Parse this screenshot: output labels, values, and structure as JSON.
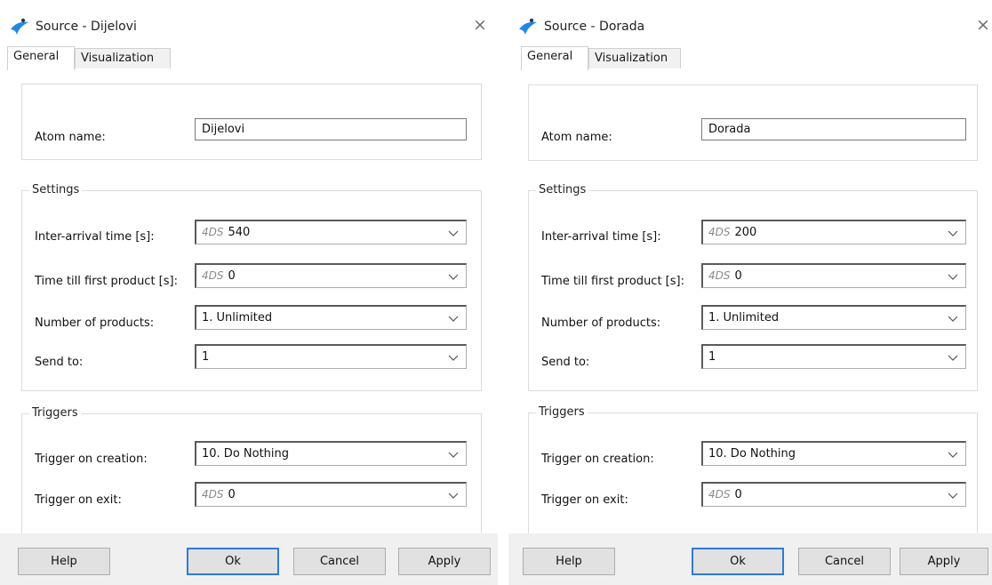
{
  "left": {
    "title": "Source - Dijelovi",
    "tabs": [
      "General",
      "Visualization"
    ],
    "atom_name_label": "Atom name:",
    "atom_name_value": "Dijelovi",
    "settings_legend": "Settings",
    "inter_arrival_label": "Inter-arrival time [s]:",
    "inter_arrival_prefix": "4DS",
    "inter_arrival_value": "540",
    "first_product_label": "Time till first product [s]:",
    "first_product_prefix": "4DS",
    "first_product_value": "0",
    "num_products_label": "Number of products:",
    "num_products_value": "1. Unlimited",
    "send_to_label": "Send to:",
    "send_to_value": "1",
    "triggers_legend": "Triggers",
    "trigger_creation_label": "Trigger on creation:",
    "trigger_creation_value": "10. Do Nothing",
    "trigger_exit_label": "Trigger on exit:",
    "trigger_exit_prefix": "4DS",
    "trigger_exit_value": "0",
    "buttons": {
      "help": "Help",
      "ok": "Ok",
      "cancel": "Cancel",
      "apply": "Apply"
    }
  },
  "right": {
    "title": "Source - Dorada",
    "tabs": [
      "General",
      "Visualization"
    ],
    "atom_name_label": "Atom name:",
    "atom_name_value": "Dorada",
    "settings_legend": "Settings",
    "inter_arrival_label": "Inter-arrival time [s]:",
    "inter_arrival_prefix": "4DS",
    "inter_arrival_value": "200",
    "first_product_label": "Time till first product [s]:",
    "first_product_prefix": "4DS",
    "first_product_value": "0",
    "num_products_label": "Number of products:",
    "num_products_value": "1. Unlimited",
    "send_to_label": "Send to:",
    "send_to_value": "1",
    "triggers_legend": "Triggers",
    "trigger_creation_label": "Trigger on creation:",
    "trigger_creation_value": "10. Do Nothing",
    "trigger_exit_label": "Trigger on exit:",
    "trigger_exit_prefix": "4DS",
    "trigger_exit_value": "0",
    "buttons": {
      "help": "Help",
      "ok": "Ok",
      "cancel": "Cancel",
      "apply": "Apply"
    }
  },
  "close_glyph": "×",
  "icons": {
    "app": "enterprise-dynamics-icon",
    "close": "close-icon",
    "dropdown": "chevron-down-icon"
  },
  "colors": {
    "accent": "#2f7bd6",
    "icon_blue": "#1e88e5",
    "icon_dark": "#2a3a4a",
    "button_bar": "#f0f0f0"
  }
}
